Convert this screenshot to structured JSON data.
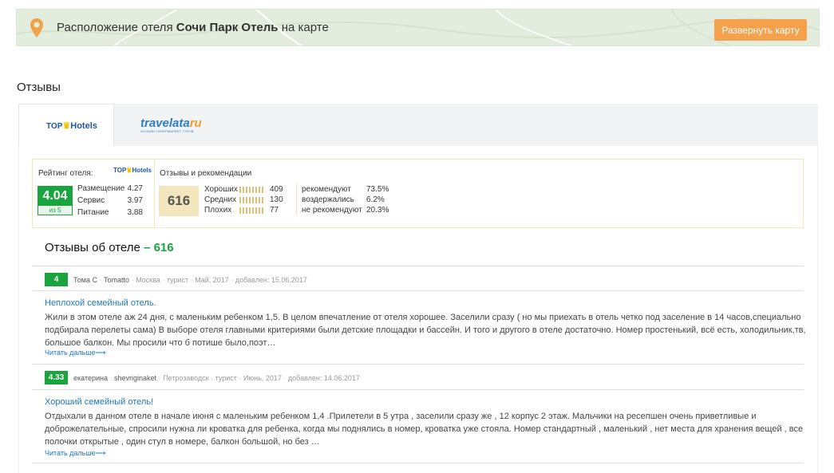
{
  "map_banner": {
    "title_prefix": "Расположение отеля",
    "hotel_name": "Сочи Парк Отель",
    "title_suffix": "на карте",
    "expand_button": "Развернуть карту",
    "accent_color": "#f5a04a"
  },
  "reviews_heading": "Отзывы",
  "tabs": [
    {
      "top": "TOP",
      "brand": "Hotels",
      "icon": "crown-icon",
      "active": true
    },
    {
      "brand": "travelata",
      "suffix": "ru",
      "tagline": "ОНЛАЙН ГИПЕРМАРКЕТ ТУРОВ",
      "active": false
    }
  ],
  "rating": {
    "label": "Рейтинг отеля:",
    "logo_top": "TOP",
    "logo_brand": "Hotels",
    "score": "4.04",
    "score_of": "из 5",
    "sub": [
      {
        "label": "Размещение",
        "value": "4.27"
      },
      {
        "label": "Сервис",
        "value": "3.97"
      },
      {
        "label": "Питание",
        "value": "3.88"
      }
    ]
  },
  "recommendations": {
    "title": "Отзывы и рекомендации",
    "total": "616",
    "grades": [
      {
        "label": "Хороших",
        "value": "409"
      },
      {
        "label": "Средних",
        "value": "130"
      },
      {
        "label": "Плохих",
        "value": "77"
      }
    ],
    "percents": [
      {
        "label": "рекомендуют",
        "value": "73.5%"
      },
      {
        "label": "воздержались",
        "value": "6.2%"
      },
      {
        "label": "не рекомендуют",
        "value": "20.3%"
      }
    ]
  },
  "reviews_list": {
    "title": "Отзывы об отеле",
    "dash": "–",
    "count": "616",
    "brand_color": "#19a43d",
    "link_color": "#1d78c1",
    "items": [
      {
        "score": "4",
        "author": "Тома С",
        "nick": "Tomatto",
        "city": "Москва",
        "type": "турист",
        "trip_date": "Май, 2017",
        "added": "добавлен: 15.06.2017",
        "title": "Неплохой семейный отель.",
        "text": "Жили в этом отеле аж 24 дня, с маленьким ребенком 1,5. В целом впечатление от отеля хорошее. Заселили сразу ( но мы приехать в отель четко под заселение в 14 часов,специально подбирала перелеты сама) В выборе отеля главными критериями были детские площадки и бассейн. И того и другого в отеле достаточно. Номер простенький, всё есть, холодильник,тв, большое балкон. Мы просили что б потише было,поэт…",
        "more": "Читать дальше⟶"
      },
      {
        "score": "4.33",
        "author": "екатерина",
        "nick": "shevriginaket",
        "city": "Петрозаводск",
        "type": "турист",
        "trip_date": "Июнь, 2017",
        "added": "добавлен: 14.06.2017",
        "title": "Хороший семейный отель!",
        "text": "Отдыхали в данном отеле в начале июня с маленьким ребенком 1,4 .Прилетели в 5 утра , заселили сразу же , 12 корпус 2 этаж. Мальчики на ресепшен очень приветливые и доброжелательные, спросили нужна ли кроватка для ребенка, когда мы поднялись в номер, кроватка уже стояла. Номер стандартный , маленький , нет места для хранения вещей , все полочки открытые , один стул в номере, балкон большой, но без …",
        "more": "Читать дальше⟶"
      }
    ]
  }
}
